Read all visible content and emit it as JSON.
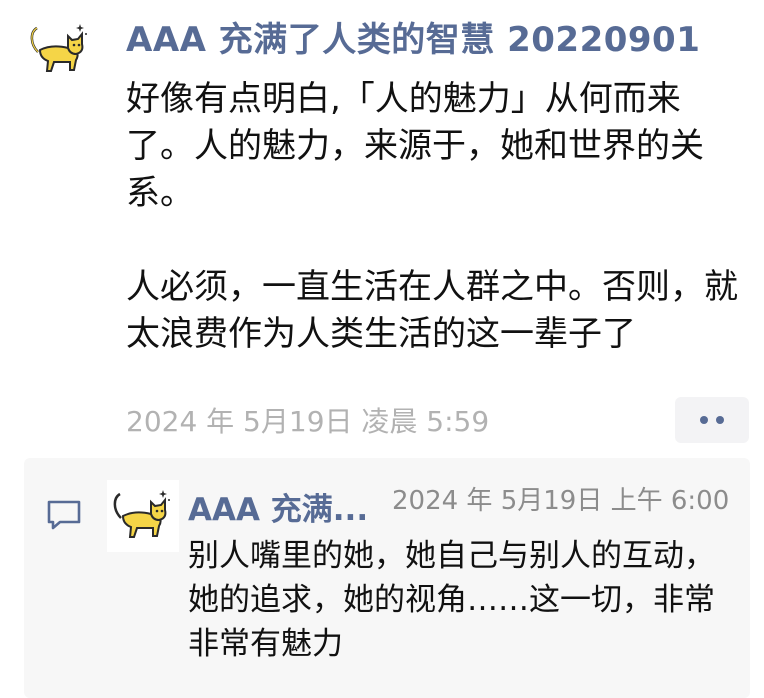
{
  "moment": {
    "author": "AAA 充满了人类的智慧 20220901",
    "paragraph_1": "好像有点明白,「人的魅力」从何而来了。人的魅力，来源于，她和世界的关系。",
    "paragraph_2": "人必须，一直生活在人群之中。否则，就太浪费作为人类生活的这一辈子了",
    "timestamp": "2024 年 5月19日 凌晨 5:59",
    "avatar_icon": "cat-icon",
    "more_icon": "more-dots-icon"
  },
  "comment": {
    "icon": "comment-bubble-icon",
    "author": "AAA 充满...",
    "time": "2024 年 5月19日 上午 6:00",
    "text": "别人嘴里的她，她自己与别人的互动，她的追求，她的视角……这一切，非常非常有魅力"
  },
  "colors": {
    "link_blue": "#576b95",
    "timestamp_gray": "#b2b2b2",
    "comment_bg": "#f7f7f7",
    "cat_yellow": "#f5d547"
  }
}
